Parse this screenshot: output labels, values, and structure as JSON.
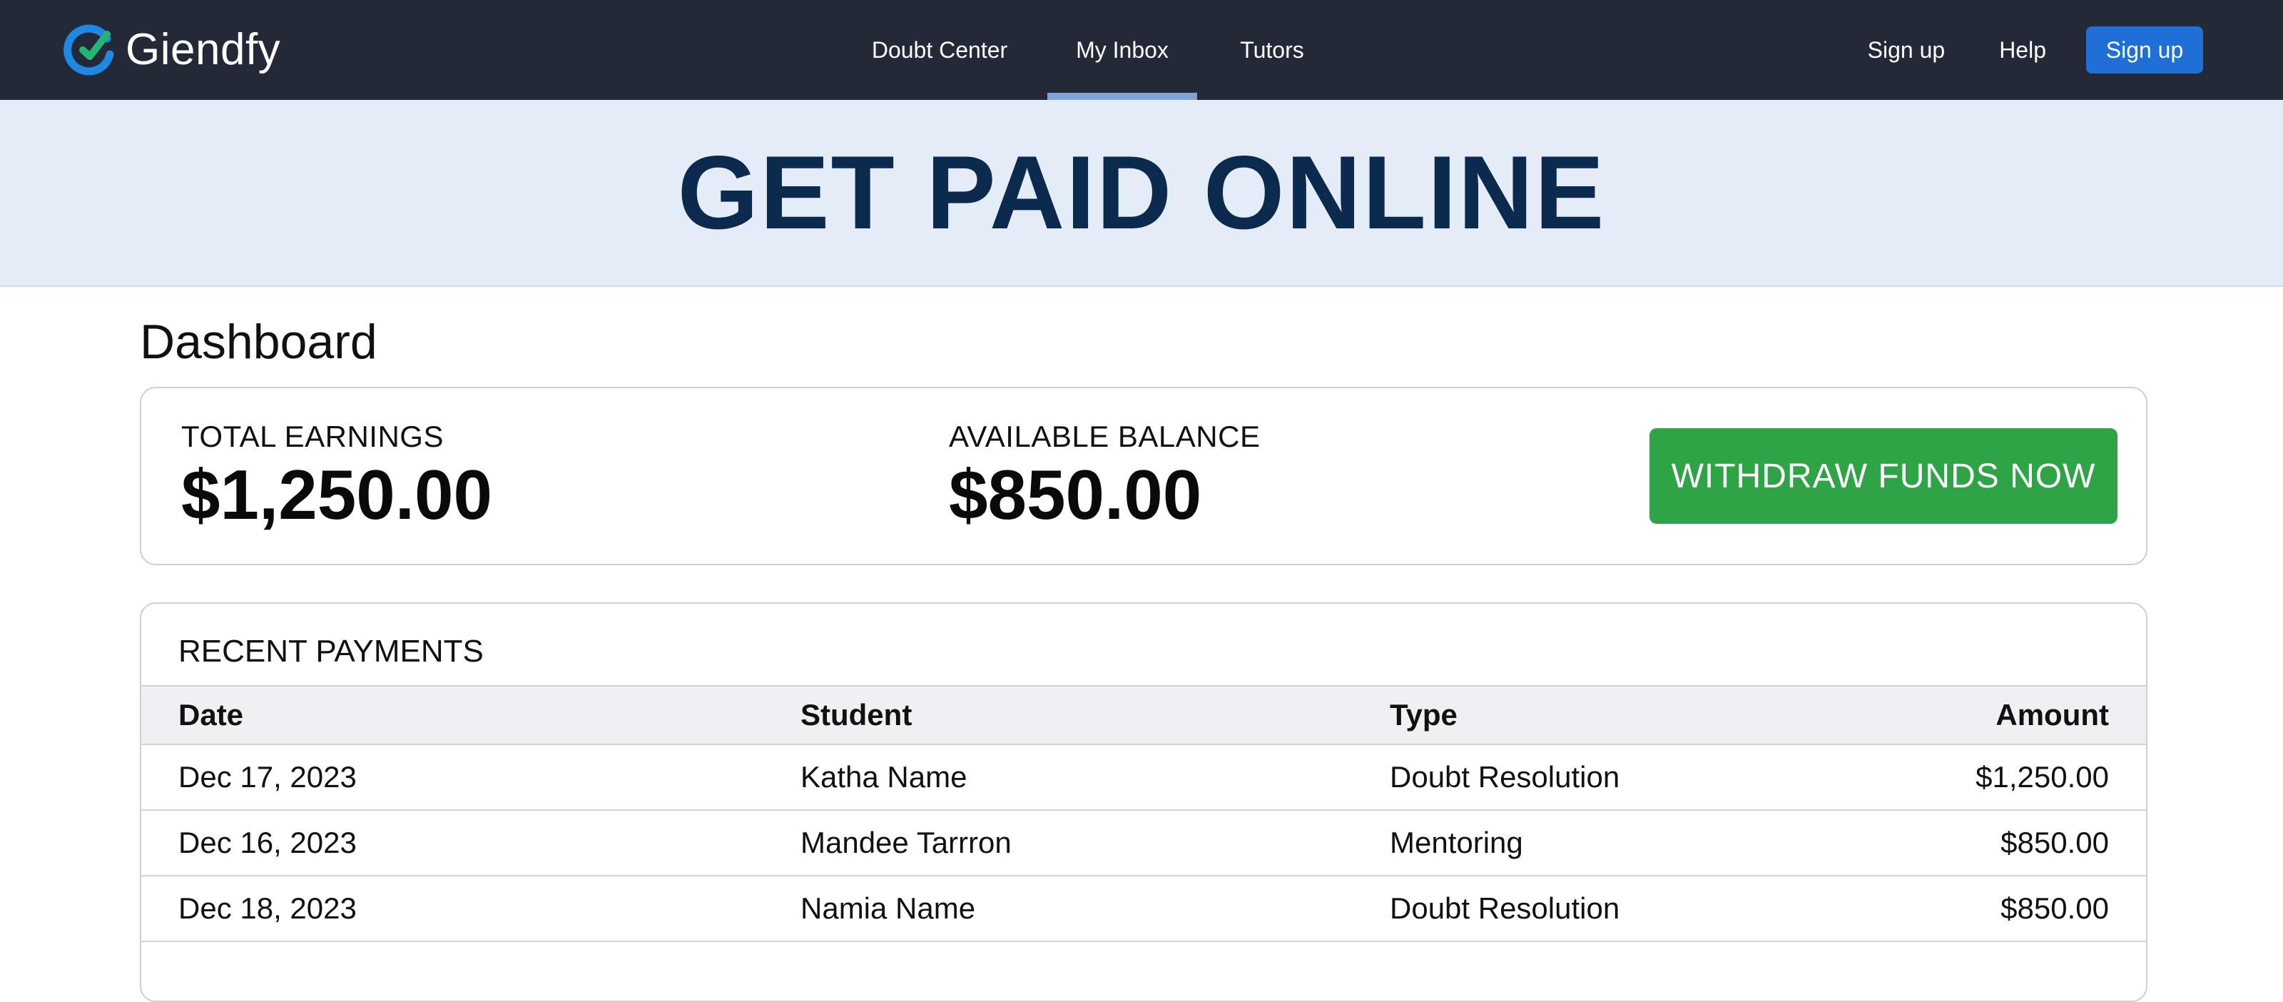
{
  "brand": {
    "name": "Giendfy",
    "accent": "#1e88e5",
    "check_color": "#22b573"
  },
  "nav": {
    "links": [
      {
        "label": "Doubt Center"
      },
      {
        "label": "My Inbox",
        "active": true
      },
      {
        "label": "Tutors"
      }
    ],
    "signup_link": "Sign up",
    "help_link": "Help",
    "signup_button": "Sign up"
  },
  "hero": {
    "title": "GET PAID ONLINE"
  },
  "dashboard": {
    "title": "Dashboard",
    "total_earnings_label": "TOTAL EARNINGS",
    "total_earnings_value": "$1,250.00",
    "available_balance_label": "AVAILABLE BALANCE",
    "available_balance_value": "$850.00",
    "withdraw_button": "WITHDRAW FUNDS NOW",
    "withdraw_color": "#2ea447"
  },
  "payments": {
    "title": "RECENT PAYMENTS",
    "columns": [
      "Date",
      "Student",
      "Type",
      "Amount"
    ],
    "rows": [
      {
        "date": "Dec 17, 2023",
        "student": "Katha Name",
        "type": "Doubt Resolution",
        "amount": "$1,250.00"
      },
      {
        "date": "Dec 16, 2023",
        "student": "Mandee Tarrron",
        "type": "Mentoring",
        "amount": "$850.00"
      },
      {
        "date": "Dec 18, 2023",
        "student": "Namia Name",
        "type": "Doubt Resolution",
        "amount": "$850.00"
      }
    ]
  }
}
